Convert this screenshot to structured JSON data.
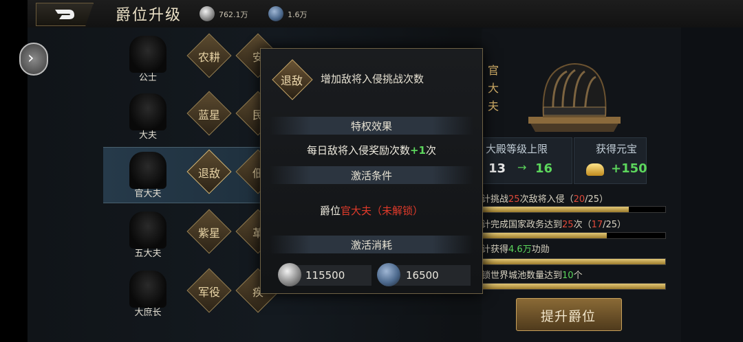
{
  "header": {
    "title": "爵位升级",
    "resources": [
      {
        "icon": "silver-coin-icon",
        "value": "762.1万"
      },
      {
        "icon": "blue-gem-icon",
        "value": "1.6万"
      }
    ]
  },
  "ranks": [
    {
      "name": "公士",
      "privileges": [
        "农耕",
        "安"
      ]
    },
    {
      "name": "大夫",
      "privileges": [
        "蓝星",
        "民"
      ]
    },
    {
      "name": "官大夫",
      "privileges": [
        "退敌",
        "佃"
      ]
    },
    {
      "name": "五大夫",
      "privileges": [
        "紫星",
        "革"
      ]
    },
    {
      "name": "大庶长",
      "privileges": [
        "军役",
        "疾"
      ]
    }
  ],
  "popup": {
    "icon_label": "退敌",
    "description": "增加敌将入侵挑战次数",
    "effect_title": "特权效果",
    "effect_text_pre": "每日敌将入侵奖励次数",
    "effect_value": "+1",
    "effect_text_post": "次",
    "condition_title": "激活条件",
    "condition_pre": "爵位",
    "condition_rank": "官大夫（未解锁）",
    "cost_title": "激活消耗",
    "costs": [
      {
        "icon": "silver-coin-icon",
        "value": "115500"
      },
      {
        "icon": "blue-gem-icon",
        "value": "16500"
      }
    ]
  },
  "right": {
    "rank_title": "官大夫",
    "stat1_label": "大殿等级上限",
    "stat1_from": "13",
    "stat1_arrow": "→",
    "stat1_to": "16",
    "stat2_label": "获得元宝",
    "stat2_value": "+150",
    "conditions": [
      {
        "pre": "计挑战",
        "num": "25",
        "post": "次敌将入侵（",
        "cur": "20",
        "total": "/25）",
        "progress": 0.8
      },
      {
        "pre": "计完成国家政务达到",
        "num": "25",
        "post": "次（",
        "cur": "17",
        "total": "/25）",
        "progress": 0.68
      },
      {
        "pre": "计获得",
        "num": "4.6万",
        "post": "功勋",
        "cur": "",
        "total": "",
        "progress": 1.0
      },
      {
        "pre": "锁世界城池数量达到",
        "num": "10",
        "post": "个",
        "cur": "",
        "total": "",
        "progress": 1.0
      }
    ],
    "upgrade_label": "提升爵位"
  },
  "colors": {
    "accent_gold": "#c9a25c",
    "highlight_red": "#e04a3a",
    "highlight_green": "#5cd65c"
  }
}
